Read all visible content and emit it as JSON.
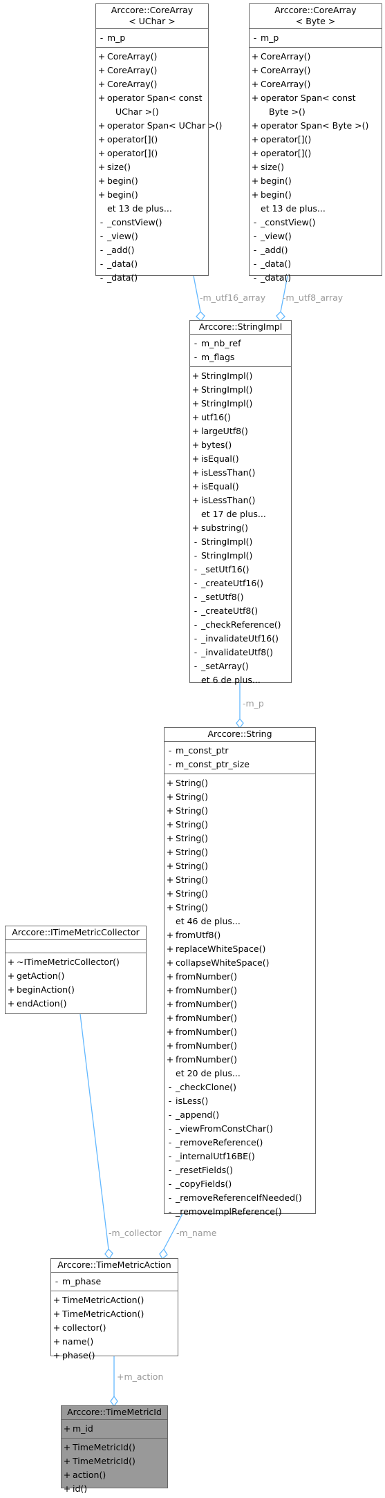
{
  "boxes": {
    "corearray_uchar": {
      "title": [
        "Arccore::CoreArray",
        "< UChar >"
      ],
      "attributes": [
        {
          "vis": "-",
          "name": "m_p"
        }
      ],
      "methods": [
        {
          "vis": "+",
          "name": "CoreArray()"
        },
        {
          "vis": "+",
          "name": "CoreArray()"
        },
        {
          "vis": "+",
          "name": "CoreArray()"
        },
        {
          "vis": "+",
          "name": "operator Span< const",
          "cont": "UChar >()"
        },
        {
          "vis": "+",
          "name": "operator Span< UChar >()"
        },
        {
          "vis": "+",
          "name": "operator[]()"
        },
        {
          "vis": "+",
          "name": "operator[]()"
        },
        {
          "vis": "+",
          "name": "size()"
        },
        {
          "vis": "+",
          "name": "begin()"
        },
        {
          "vis": "+",
          "name": "begin()"
        },
        {
          "vis": "",
          "name": "et 13 de plus..."
        },
        {
          "vis": "-",
          "name": "_constView()"
        },
        {
          "vis": "-",
          "name": "_view()"
        },
        {
          "vis": "-",
          "name": "_add()"
        },
        {
          "vis": "-",
          "name": "_data()"
        },
        {
          "vis": "-",
          "name": "_data()"
        }
      ]
    },
    "corearray_byte": {
      "title": [
        "Arccore::CoreArray",
        "< Byte >"
      ],
      "attributes": [
        {
          "vis": "-",
          "name": "m_p"
        }
      ],
      "methods": [
        {
          "vis": "+",
          "name": "CoreArray()"
        },
        {
          "vis": "+",
          "name": "CoreArray()"
        },
        {
          "vis": "+",
          "name": "CoreArray()"
        },
        {
          "vis": "+",
          "name": "operator Span< const",
          "cont": "Byte >()"
        },
        {
          "vis": "+",
          "name": "operator Span< Byte >()"
        },
        {
          "vis": "+",
          "name": "operator[]()"
        },
        {
          "vis": "+",
          "name": "operator[]()"
        },
        {
          "vis": "+",
          "name": "size()"
        },
        {
          "vis": "+",
          "name": "begin()"
        },
        {
          "vis": "+",
          "name": "begin()"
        },
        {
          "vis": "",
          "name": "et 13 de plus..."
        },
        {
          "vis": "-",
          "name": "_constView()"
        },
        {
          "vis": "-",
          "name": "_view()"
        },
        {
          "vis": "-",
          "name": "_add()"
        },
        {
          "vis": "-",
          "name": "_data()"
        },
        {
          "vis": "-",
          "name": "_data()"
        }
      ]
    },
    "stringimpl": {
      "title": [
        "Arccore::StringImpl"
      ],
      "attributes": [
        {
          "vis": "-",
          "name": "m_nb_ref"
        },
        {
          "vis": "-",
          "name": "m_flags"
        }
      ],
      "methods": [
        {
          "vis": "+",
          "name": "StringImpl()"
        },
        {
          "vis": "+",
          "name": "StringImpl()"
        },
        {
          "vis": "+",
          "name": "StringImpl()"
        },
        {
          "vis": "+",
          "name": "utf16()"
        },
        {
          "vis": "+",
          "name": "largeUtf8()"
        },
        {
          "vis": "+",
          "name": "bytes()"
        },
        {
          "vis": "+",
          "name": "isEqual()"
        },
        {
          "vis": "+",
          "name": "isLessThan()"
        },
        {
          "vis": "+",
          "name": "isEqual()"
        },
        {
          "vis": "+",
          "name": "isLessThan()"
        },
        {
          "vis": "",
          "name": "et 17 de plus..."
        },
        {
          "vis": "+",
          "name": "substring()"
        },
        {
          "vis": "-",
          "name": "StringImpl()"
        },
        {
          "vis": "-",
          "name": "StringImpl()"
        },
        {
          "vis": "-",
          "name": "_setUtf16()"
        },
        {
          "vis": "-",
          "name": "_createUtf16()"
        },
        {
          "vis": "-",
          "name": "_setUtf8()"
        },
        {
          "vis": "-",
          "name": "_createUtf8()"
        },
        {
          "vis": "-",
          "name": "_checkReference()"
        },
        {
          "vis": "-",
          "name": "_invalidateUtf16()"
        },
        {
          "vis": "-",
          "name": "_invalidateUtf8()"
        },
        {
          "vis": "-",
          "name": "_setArray()"
        },
        {
          "vis": "",
          "name": "et 6 de plus..."
        }
      ]
    },
    "string": {
      "title": [
        "Arccore::String"
      ],
      "attributes": [
        {
          "vis": "-",
          "name": "m_const_ptr"
        },
        {
          "vis": "-",
          "name": "m_const_ptr_size"
        }
      ],
      "methods": [
        {
          "vis": "+",
          "name": "String()"
        },
        {
          "vis": "+",
          "name": "String()"
        },
        {
          "vis": "+",
          "name": "String()"
        },
        {
          "vis": "+",
          "name": "String()"
        },
        {
          "vis": "+",
          "name": "String()"
        },
        {
          "vis": "+",
          "name": "String()"
        },
        {
          "vis": "+",
          "name": "String()"
        },
        {
          "vis": "+",
          "name": "String()"
        },
        {
          "vis": "+",
          "name": "String()"
        },
        {
          "vis": "+",
          "name": "String()"
        },
        {
          "vis": "",
          "name": "et 46 de plus..."
        },
        {
          "vis": "+",
          "name": "fromUtf8()"
        },
        {
          "vis": "+",
          "name": "replaceWhiteSpace()"
        },
        {
          "vis": "+",
          "name": "collapseWhiteSpace()"
        },
        {
          "vis": "+",
          "name": "fromNumber()"
        },
        {
          "vis": "+",
          "name": "fromNumber()"
        },
        {
          "vis": "+",
          "name": "fromNumber()"
        },
        {
          "vis": "+",
          "name": "fromNumber()"
        },
        {
          "vis": "+",
          "name": "fromNumber()"
        },
        {
          "vis": "+",
          "name": "fromNumber()"
        },
        {
          "vis": "+",
          "name": "fromNumber()"
        },
        {
          "vis": "",
          "name": "et 20 de plus..."
        },
        {
          "vis": "-",
          "name": "_checkClone()"
        },
        {
          "vis": "-",
          "name": "isLess()"
        },
        {
          "vis": "-",
          "name": "_append()"
        },
        {
          "vis": "-",
          "name": "_viewFromConstChar()"
        },
        {
          "vis": "-",
          "name": "_removeReference()"
        },
        {
          "vis": "-",
          "name": "_internalUtf16BE()"
        },
        {
          "vis": "-",
          "name": "_resetFields()"
        },
        {
          "vis": "-",
          "name": "_copyFields()"
        },
        {
          "vis": "-",
          "name": "_removeReferenceIfNeeded()"
        },
        {
          "vis": "-",
          "name": "_removeImplReference()"
        }
      ]
    },
    "itimemetriccollector": {
      "title": [
        "Arccore::ITimeMetricCollector"
      ],
      "attributes": [],
      "methods": [
        {
          "vis": "+",
          "name": "~ITimeMetricCollector()"
        },
        {
          "vis": "+",
          "name": "getAction()"
        },
        {
          "vis": "+",
          "name": "beginAction()"
        },
        {
          "vis": "+",
          "name": "endAction()"
        }
      ]
    },
    "timemetricaction": {
      "title": [
        "Arccore::TimeMetricAction"
      ],
      "attributes": [
        {
          "vis": "-",
          "name": "m_phase"
        }
      ],
      "methods": [
        {
          "vis": "+",
          "name": "TimeMetricAction()"
        },
        {
          "vis": "+",
          "name": "TimeMetricAction()"
        },
        {
          "vis": "+",
          "name": "collector()"
        },
        {
          "vis": "+",
          "name": "name()"
        },
        {
          "vis": "+",
          "name": "phase()"
        }
      ]
    },
    "timemetricid": {
      "title": [
        "Arccore::TimeMetricId"
      ],
      "attributes": [
        {
          "vis": "+",
          "name": "m_id"
        }
      ],
      "methods": [
        {
          "vis": "+",
          "name": "TimeMetricId()"
        },
        {
          "vis": "+",
          "name": "TimeMetricId()"
        },
        {
          "vis": "+",
          "name": "action()"
        },
        {
          "vis": "+",
          "name": "id()"
        }
      ]
    }
  },
  "edges": {
    "utf16": "-m_utf16_array",
    "utf8": "-m_utf8_array",
    "m_p": "-m_p",
    "collector": "-m_collector",
    "name": "-m_name",
    "action": "+m_action"
  },
  "colors": {
    "edge": "#63b8ff",
    "border": "#666666",
    "focus_fill": "#999999",
    "label": "#9a9a9a"
  }
}
